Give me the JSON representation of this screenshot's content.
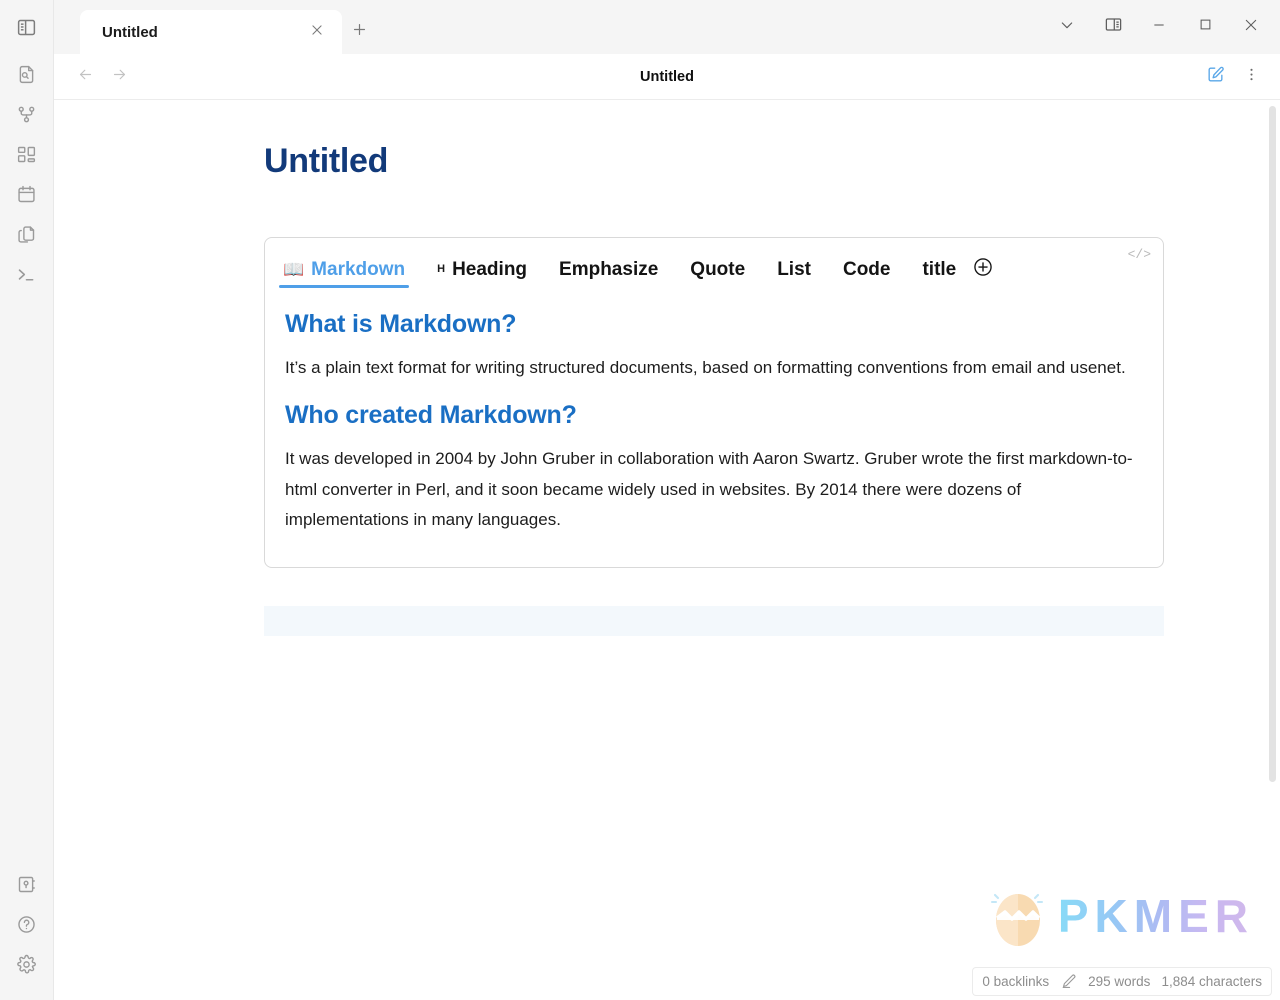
{
  "app": {
    "accent_blue": "#4f9fe8",
    "heading_blue": "#1a6fc4",
    "title_navy": "#123a7a"
  },
  "ribbon": {
    "top": {
      "name": "toggle-left-sidebar",
      "label": "Toggle left sidebar"
    },
    "items": [
      {
        "icon": "file-search-icon",
        "label": "Search in file"
      },
      {
        "icon": "git-graph-icon",
        "label": "Graph view"
      },
      {
        "icon": "dashboard-grid-icon",
        "label": "Dashboard"
      },
      {
        "icon": "calendar-icon",
        "label": "Calendar"
      },
      {
        "icon": "copy-files-icon",
        "label": "Templates"
      },
      {
        "icon": "terminal-icon",
        "label": "Terminal"
      }
    ],
    "bottom": [
      {
        "icon": "vault-icon",
        "label": "Open another vault"
      },
      {
        "icon": "help-icon",
        "label": "Help"
      },
      {
        "icon": "settings-gear-icon",
        "label": "Settings"
      }
    ]
  },
  "tabstrip": {
    "tab_title": "Untitled",
    "close_label": "Close tab",
    "new_tab_label": "New tab",
    "window_controls": [
      {
        "icon": "chevron-down-icon",
        "label": "More tab options"
      },
      {
        "icon": "right-sidebar-icon",
        "label": "Toggle right sidebar"
      },
      {
        "icon": "minimize-icon",
        "label": "Minimize"
      },
      {
        "icon": "maximize-icon",
        "label": "Maximize"
      },
      {
        "icon": "close-icon",
        "label": "Close"
      }
    ]
  },
  "viewheader": {
    "back_label": "Navigate back",
    "forward_label": "Navigate forward",
    "title": "Untitled",
    "edit_label": "Edit",
    "more_label": "More options"
  },
  "document": {
    "page_title": "Untitled"
  },
  "card": {
    "tabs": [
      {
        "label": "Markdown",
        "emoji": "📖",
        "active": true
      },
      {
        "label": "Heading",
        "prefix": "H",
        "active": false
      },
      {
        "label": "Emphasize",
        "active": false
      },
      {
        "label": "Quote",
        "active": false
      },
      {
        "label": "List",
        "active": false
      },
      {
        "label": "Code",
        "active": false
      },
      {
        "label": "title",
        "active": false
      }
    ],
    "add_tab_label": "+",
    "code_icon_label": "</>",
    "sections": [
      {
        "heading": "What is Markdown?",
        "paragraph": "It’s a plain text format for writing structured documents, based on formatting conventions from email and usenet."
      },
      {
        "heading": "Who created Markdown?",
        "paragraph": "It was developed in 2004 by John Gruber in collaboration with Aaron Swartz. Gruber wrote the first markdown-to-html converter in Perl, and it soon became widely used in websites. By 2014 there were dozens of implementations in many languages."
      }
    ]
  },
  "watermark": {
    "text": "PKMER"
  },
  "statusbar": {
    "backlinks": "0 backlinks",
    "pencil_label": "Edit mode",
    "words": "295 words",
    "characters": "1,884 characters"
  }
}
